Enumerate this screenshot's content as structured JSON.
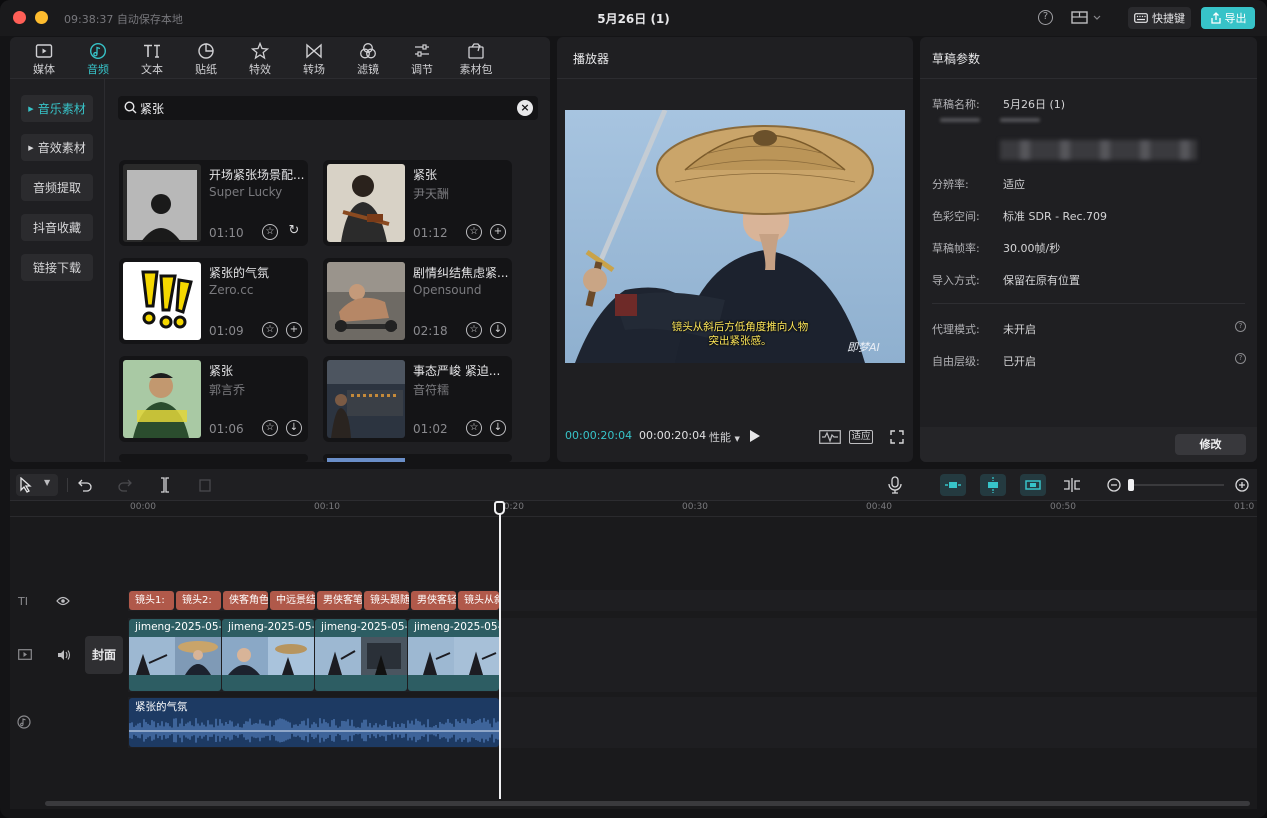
{
  "titlebar": {
    "save_status": "09:38:37 自动保存本地",
    "doc_title": "5月26日 (1)",
    "help": "?",
    "shortcut_label": "快捷键",
    "export_label": "导出"
  },
  "tabs": [
    {
      "label": "媒体",
      "icon": "media-icon"
    },
    {
      "label": "音频",
      "icon": "audio-icon",
      "active": true
    },
    {
      "label": "文本",
      "icon": "text-icon"
    },
    {
      "label": "贴纸",
      "icon": "sticker-icon"
    },
    {
      "label": "特效",
      "icon": "effects-icon"
    },
    {
      "label": "转场",
      "icon": "transition-icon"
    },
    {
      "label": "滤镜",
      "icon": "filter-icon"
    },
    {
      "label": "调节",
      "icon": "adjust-icon"
    },
    {
      "label": "素材包",
      "icon": "package-icon"
    }
  ],
  "sidebar": [
    "音乐素材",
    "音效素材",
    "音频提取",
    "抖音收藏",
    "链接下载"
  ],
  "search": {
    "value": "紧张"
  },
  "tracks_list": [
    {
      "title": "开场紧张场景配...",
      "artist": "Super Lucky",
      "duration": "01:10",
      "action": "C"
    },
    {
      "title": "紧张",
      "artist": "尹天酬",
      "duration": "01:12",
      "action": "+"
    },
    {
      "title": "紧张的气氛",
      "artist": "Zero.cc",
      "duration": "01:09",
      "action": "+"
    },
    {
      "title": "剧情纠结焦虑紧...",
      "artist": "Opensound",
      "duration": "02:18",
      "action": "↓"
    },
    {
      "title": "紧张",
      "artist": "郭言乔",
      "duration": "01:06",
      "action": "↓"
    },
    {
      "title": "事态严峻 紧迫...",
      "artist": "音符糯",
      "duration": "01:02",
      "action": "↓"
    }
  ],
  "player": {
    "title": "播放器",
    "subtitle_line1": "镜头从斜后方低角度推向人物",
    "subtitle_line2": "突出紧张感。",
    "watermark": "即梦AI",
    "current_time": "00:00:20:04",
    "total_time": "00:00:20:04",
    "quality": "性能",
    "fit_label": "适应"
  },
  "params": {
    "title": "草稿参数",
    "rows": [
      {
        "label": "草稿名称:",
        "value": "5月26日 (1)"
      },
      {
        "label": "分辨率:",
        "value": "适应"
      },
      {
        "label": "色彩空间:",
        "value": "标准 SDR - Rec.709"
      },
      {
        "label": "草稿帧率:",
        "value": "30.00帧/秒"
      },
      {
        "label": "导入方式:",
        "value": "保留在原有位置"
      },
      {
        "label": "代理模式:",
        "value": "未开启"
      },
      {
        "label": "自由层级:",
        "value": "已开启"
      }
    ],
    "modify_label": "修改"
  },
  "timeline": {
    "ticks": [
      "00:00",
      "00:10",
      "00:20",
      "00:30",
      "00:40",
      "00:50",
      "01:0"
    ],
    "text_clips": [
      "镜头1: ",
      "镜头2: ",
      "侠客角色",
      "中远景结",
      "男侠客笔",
      "镜头跟随",
      "男侠客轻",
      "镜头从斜"
    ],
    "video_clips": [
      "jimeng-2025-05-2",
      "jimeng-2025-05-2",
      "jimeng-2025-05-2",
      "jimeng-2025-05-2"
    ],
    "audio_clip": "紧张的气氛",
    "cover_label": "封面",
    "text_track_label": "TI"
  },
  "colors": {
    "accent": "#37c3c8",
    "text_clip": "#b0594a",
    "video_clip": "#2d5d63",
    "audio_clip": "#1d3a63"
  }
}
